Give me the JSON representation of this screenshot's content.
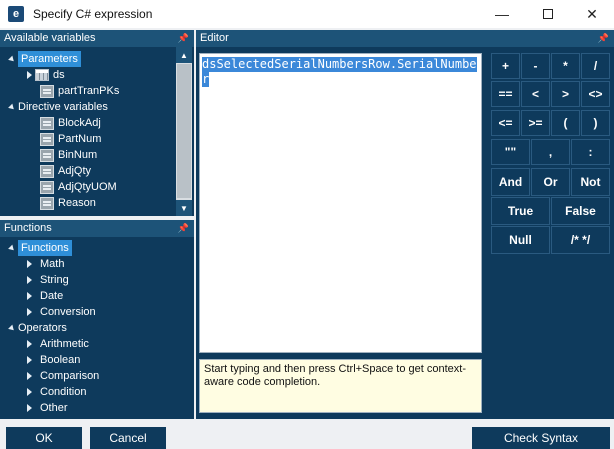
{
  "window": {
    "title": "Specify C# expression",
    "icon_letter": "e",
    "minimize": "—",
    "close": "✕"
  },
  "variables_panel": {
    "title": "Available variables",
    "parameters_label": "Parameters",
    "ds_label": "ds",
    "part_tran_label": "partTranPKs",
    "directive_label": "Directive variables",
    "items": [
      "BlockAdj",
      "PartNum",
      "BinNum",
      "AdjQty",
      "AdjQtyUOM",
      "Reason"
    ]
  },
  "functions_panel": {
    "title": "Functions",
    "functions_label": "Functions",
    "function_items": [
      "Math",
      "String",
      "Date",
      "Conversion"
    ],
    "operators_label": "Operators",
    "operator_items": [
      "Arithmetic",
      "Boolean",
      "Comparison",
      "Condition",
      "Other"
    ]
  },
  "editor": {
    "title": "Editor",
    "code_line_1": "dsSelectedSerialNumbersRow.SerialNumbe",
    "code_line_2": "r",
    "hint": "Start typing and then press Ctrl+Space to get context-aware code completion."
  },
  "operators": {
    "plus": "+",
    "minus": "-",
    "multiply": "*",
    "divide": "/",
    "equal": "==",
    "less": "<",
    "greater": ">",
    "not_equal": "<>",
    "less_equal": "<=",
    "greater_equal": ">=",
    "open_paren": "(",
    "close_paren": ")",
    "quotes": "\"\"",
    "comma": ",",
    "colon": ":",
    "and": "And",
    "or": "Or",
    "not": "Not",
    "true": "True",
    "false": "False",
    "null": "Null",
    "comment": "/* */"
  },
  "buttons": {
    "ok": "OK",
    "cancel": "Cancel",
    "check_syntax": "Check Syntax"
  },
  "colors": {
    "panel": "#0e3a5c",
    "header": "#1d5378",
    "selection": "#2f8fd8",
    "hint_bg": "#fffde2"
  }
}
